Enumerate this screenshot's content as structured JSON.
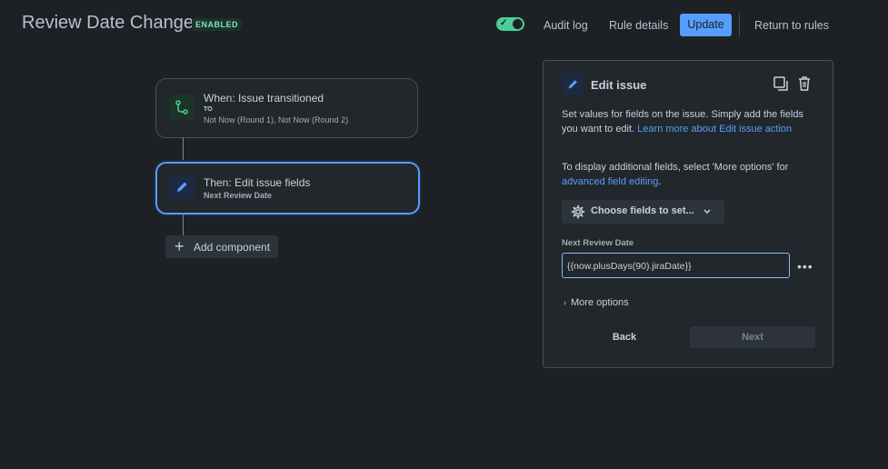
{
  "header": {
    "title": "Review Date Change",
    "status_badge": "ENABLED",
    "rule_enabled": true,
    "audit_log": "Audit log",
    "rule_details": "Rule details",
    "update": "Update",
    "return_to_rules": "Return to rules"
  },
  "flow": {
    "trigger": {
      "title": "When: Issue transitioned",
      "to_label": "TO",
      "statuses": "Not Now (Round 1), Not Now (Round 2)"
    },
    "action": {
      "title": "Then: Edit issue fields",
      "field": "Next Review Date"
    },
    "add_component": "Add component"
  },
  "panel": {
    "title": "Edit issue",
    "description": "Set values for fields on the issue. Simply add the fields you want to edit.",
    "learn_more_link": "Learn more about Edit issue action",
    "display_text": "To display additional fields, select 'More options' for",
    "advanced_link": "advanced field editing",
    "choose_fields": "Choose fields to set...",
    "field_label": "Next Review Date",
    "field_value": "{{now.plusDays(90).jiraDate}}",
    "more_options": "More options",
    "back": "Back",
    "next": "Next"
  },
  "colors": {
    "background": "#1d2125",
    "accent": "#579dff",
    "enabled_green": "#4bce97"
  },
  "icons": {
    "trigger": "branch-icon",
    "action": "pencil-icon",
    "duplicate": "copy-icon",
    "delete": "trash-icon",
    "choose_fields": "gear-icon"
  }
}
